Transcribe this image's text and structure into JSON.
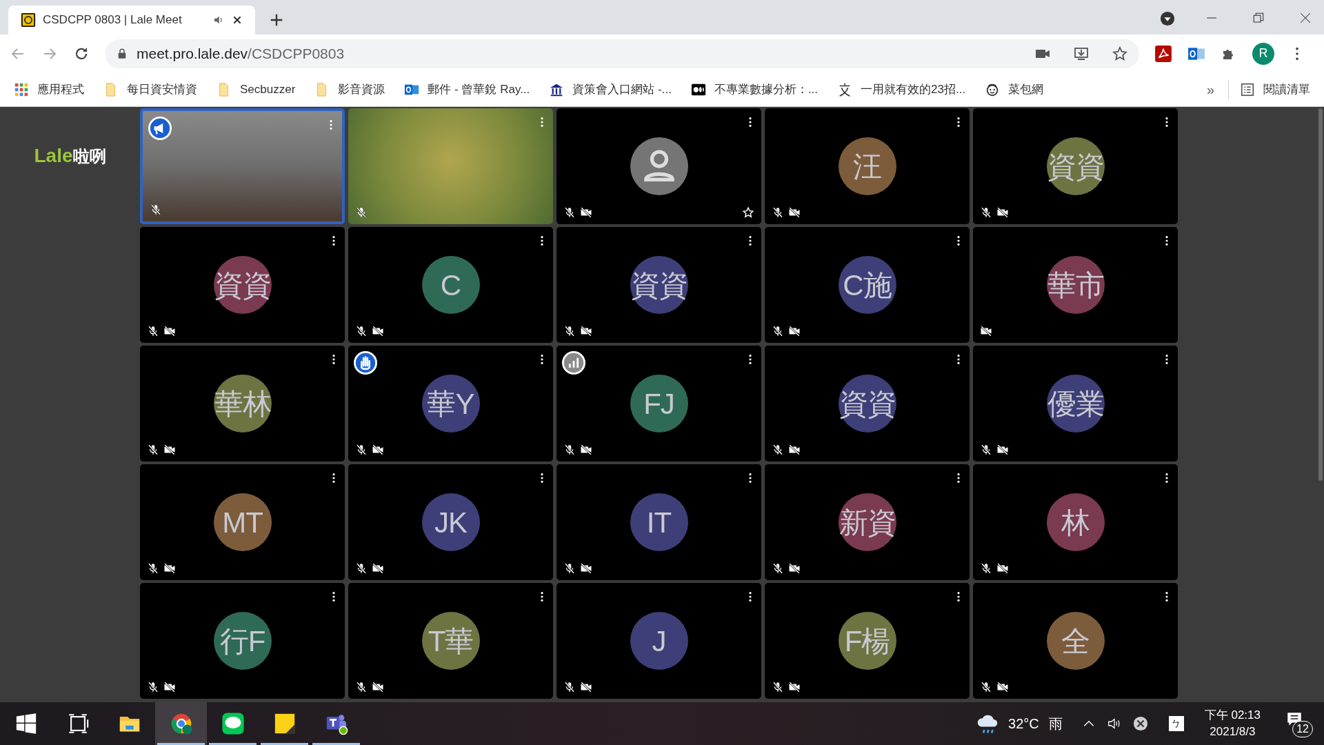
{
  "browser": {
    "tabs": [
      {
        "title": "CSDCPP 0803 | Lale Meet",
        "selected": true,
        "audio_playing": true
      }
    ],
    "address": {
      "host": "meet.pro.lale.dev",
      "path": "/CSDCPP0803"
    },
    "bookmarks": [
      {
        "kind": "apps",
        "label": "應用程式"
      },
      {
        "kind": "folder",
        "label": "每日資安情資"
      },
      {
        "kind": "folder",
        "label": "Secbuzzer"
      },
      {
        "kind": "folder",
        "label": "影音資源"
      },
      {
        "kind": "mail",
        "label": "郵件 - 曾華銳 Ray..."
      },
      {
        "kind": "building",
        "label": "資策會入口網站 -..."
      },
      {
        "kind": "dots",
        "label": "不專業數據分析：..."
      },
      {
        "kind": "translate",
        "label": "一用就有效的23招..."
      },
      {
        "kind": "face",
        "label": "菜包網"
      }
    ],
    "overflow": "»",
    "reading_list": "閱讀清單",
    "profile_initial": "R"
  },
  "page": {
    "logo": {
      "brand": "Lale",
      "suffix": "啦咧"
    },
    "tiles": [
      {
        "kind": "video",
        "highlighted": true,
        "badge": {
          "kind": "presenter"
        },
        "mic_muted": true,
        "cam_off": false,
        "starred": false
      },
      {
        "kind": "blank_video",
        "highlighted": false,
        "mic_muted": true,
        "cam_off": false,
        "starred": false
      },
      {
        "kind": "default_avatar",
        "highlighted": false,
        "mic_muted": true,
        "cam_off": true,
        "starred": true
      },
      {
        "kind": "initials",
        "initials": "汪",
        "color": "#7c5c3b",
        "highlighted": false,
        "mic_muted": true,
        "cam_off": true,
        "starred": false
      },
      {
        "kind": "initials",
        "initials": "資資",
        "color": "#6d7442",
        "highlighted": false,
        "mic_muted": true,
        "cam_off": true,
        "starred": false
      },
      {
        "kind": "initials",
        "initials": "資資",
        "color": "#7a3a50",
        "highlighted": false,
        "mic_muted": true,
        "cam_off": true,
        "starred": false
      },
      {
        "kind": "initials",
        "initials": "C",
        "color": "#2e6a55",
        "highlighted": false,
        "mic_muted": true,
        "cam_off": true,
        "starred": false
      },
      {
        "kind": "initials",
        "initials": "資資",
        "color": "#3e3e78",
        "highlighted": false,
        "mic_muted": true,
        "cam_off": true,
        "starred": false
      },
      {
        "kind": "initials",
        "initials": "C施",
        "color": "#3e3e78",
        "highlighted": false,
        "mic_muted": true,
        "cam_off": true,
        "starred": false
      },
      {
        "kind": "initials",
        "initials": "華市",
        "color": "#7a3a50",
        "highlighted": false,
        "mic_muted": false,
        "cam_off": true,
        "starred": false
      },
      {
        "kind": "initials",
        "initials": "華林",
        "color": "#6d7442",
        "highlighted": false,
        "mic_muted": true,
        "cam_off": true,
        "starred": false
      },
      {
        "kind": "initials",
        "initials": "華Y",
        "color": "#3e3e78",
        "highlighted": false,
        "badge": {
          "kind": "hand"
        },
        "mic_muted": true,
        "cam_off": true,
        "starred": false
      },
      {
        "kind": "initials",
        "initials": "FJ",
        "color": "#2e6a55",
        "highlighted": false,
        "badge": {
          "kind": "signal"
        },
        "mic_muted": true,
        "cam_off": true,
        "starred": false
      },
      {
        "kind": "initials",
        "initials": "資資",
        "color": "#3e3e78",
        "highlighted": false,
        "mic_muted": true,
        "cam_off": true,
        "starred": false
      },
      {
        "kind": "initials",
        "initials": "優業",
        "color": "#3e3e78",
        "highlighted": false,
        "mic_muted": true,
        "cam_off": true,
        "starred": false
      },
      {
        "kind": "initials",
        "initials": "MT",
        "color": "#7c5c3b",
        "highlighted": false,
        "mic_muted": true,
        "cam_off": true,
        "starred": false
      },
      {
        "kind": "initials",
        "initials": "JK",
        "color": "#3e3e78",
        "highlighted": false,
        "mic_muted": true,
        "cam_off": true,
        "starred": false
      },
      {
        "kind": "initials",
        "initials": "IT",
        "color": "#3e3e78",
        "highlighted": false,
        "mic_muted": true,
        "cam_off": true,
        "starred": false
      },
      {
        "kind": "initials",
        "initials": "新資",
        "color": "#7a3a50",
        "highlighted": false,
        "mic_muted": true,
        "cam_off": true,
        "starred": false
      },
      {
        "kind": "initials",
        "initials": "林",
        "color": "#7a3a50",
        "highlighted": false,
        "mic_muted": true,
        "cam_off": true,
        "starred": false
      },
      {
        "kind": "initials",
        "initials": "行F",
        "color": "#2e6a55",
        "highlighted": false,
        "mic_muted": true,
        "cam_off": true,
        "starred": false
      },
      {
        "kind": "initials",
        "initials": "T華",
        "color": "#6d7442",
        "highlighted": false,
        "mic_muted": true,
        "cam_off": true,
        "starred": false
      },
      {
        "kind": "initials",
        "initials": "J",
        "color": "#3e3e78",
        "highlighted": false,
        "mic_muted": true,
        "cam_off": true,
        "starred": false
      },
      {
        "kind": "initials",
        "initials": "F楊",
        "color": "#6d7442",
        "highlighted": false,
        "mic_muted": true,
        "cam_off": true,
        "starred": false
      },
      {
        "kind": "initials",
        "initials": "全",
        "color": "#7c5c3b",
        "highlighted": false,
        "mic_muted": true,
        "cam_off": true,
        "starred": false
      }
    ]
  },
  "taskbar": {
    "apps": [
      {
        "kind": "start",
        "active": false
      },
      {
        "kind": "task_view",
        "active": false
      },
      {
        "kind": "explorer",
        "active": false
      },
      {
        "kind": "chrome",
        "active": true
      },
      {
        "kind": "line",
        "active": false
      },
      {
        "kind": "sticky_notes",
        "active": false
      },
      {
        "kind": "teams",
        "active": false
      }
    ],
    "running": [
      false,
      false,
      false,
      true,
      true,
      true,
      true
    ],
    "weather": {
      "temperature": "32°C",
      "condition": "雨"
    },
    "ime": "ㄅ",
    "clock": {
      "time": "下午 02:13",
      "date": "2021/8/3"
    },
    "notifications": "12"
  }
}
